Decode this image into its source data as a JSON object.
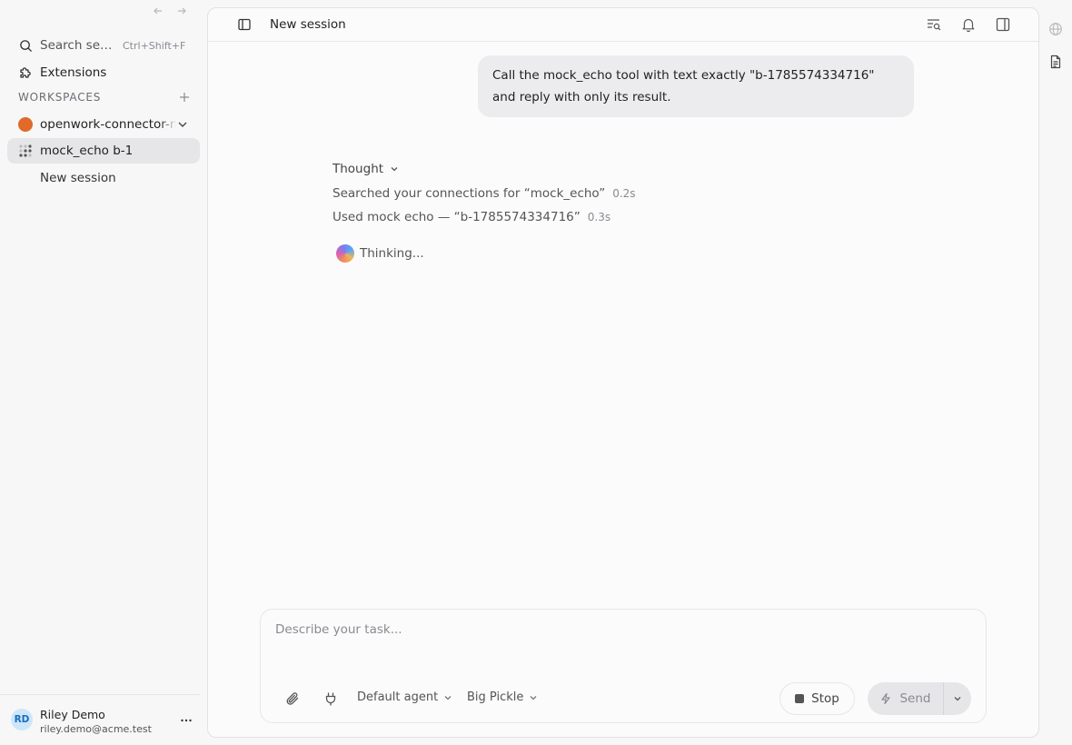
{
  "sidebar": {
    "search_label": "Search sessions",
    "search_shortcut": "Ctrl+Shift+F",
    "extensions_label": "Extensions",
    "workspaces_label": "WORKSPACES",
    "workspace_name": "openwork-connector-mock",
    "workspace_color": "#e06a2a",
    "active_session": "mock_echo b-1",
    "new_session_label": "New session"
  },
  "user": {
    "initials": "RD",
    "name": "Riley Demo",
    "email": "riley.demo@acme.test"
  },
  "header": {
    "title": "New session"
  },
  "conversation": {
    "user_message": "Call the mock_echo tool with text exactly \"b-1785574334716\" and reply with only its result.",
    "thought_label": "Thought",
    "steps": [
      {
        "text": "Searched your connections for “mock_echo”",
        "duration": "0.2s"
      },
      {
        "text": "Used mock echo — “b-1785574334716”",
        "duration": "0.3s"
      }
    ],
    "thinking_label": "Thinking..."
  },
  "composer": {
    "placeholder": "Describe your task...",
    "agent": "Default agent",
    "model": "Big Pickle",
    "stop_label": "Stop",
    "send_label": "Send"
  },
  "icons": {
    "sidebar": [
      "back-arrow-icon",
      "forward-arrow-icon",
      "search-icon",
      "puzzle-icon",
      "plus-icon",
      "chevron-down-icon",
      "dots-grid-icon",
      "more-icon"
    ],
    "header": [
      "sidebar-toggle-icon",
      "search-list-icon",
      "bell-icon",
      "panel-right-icon"
    ],
    "composer": [
      "paperclip-icon",
      "plug-icon",
      "stop-icon",
      "bolt-icon",
      "chevron-down-icon"
    ],
    "right_rail": [
      "globe-icon",
      "document-icon"
    ]
  }
}
